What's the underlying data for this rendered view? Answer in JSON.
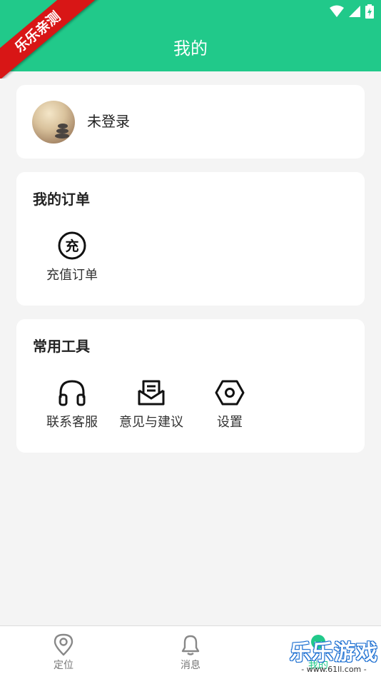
{
  "header": {
    "title": "我的",
    "ribbon_text": "乐乐亲测",
    "color": "#21c98a"
  },
  "profile": {
    "name": "未登录"
  },
  "orders": {
    "title": "我的订单",
    "items": [
      {
        "label": "充值订单",
        "icon": "recharge-icon",
        "icon_glyph": "充"
      }
    ]
  },
  "tools": {
    "title": "常用工具",
    "items": [
      {
        "label": "联系客服",
        "icon": "headset-icon"
      },
      {
        "label": "意见与建议",
        "icon": "feedback-mail-icon"
      },
      {
        "label": "设置",
        "icon": "settings-hexagon-icon"
      }
    ]
  },
  "bottom_nav": {
    "items": [
      {
        "label": "定位",
        "icon": "location-pin-icon",
        "active": false
      },
      {
        "label": "消息",
        "icon": "bell-icon",
        "active": false
      },
      {
        "label": "我的",
        "icon": "profile-smile-icon",
        "active": true
      }
    ]
  },
  "watermark": {
    "text": "乐乐游戏",
    "url": "- www.61ll.com -"
  }
}
